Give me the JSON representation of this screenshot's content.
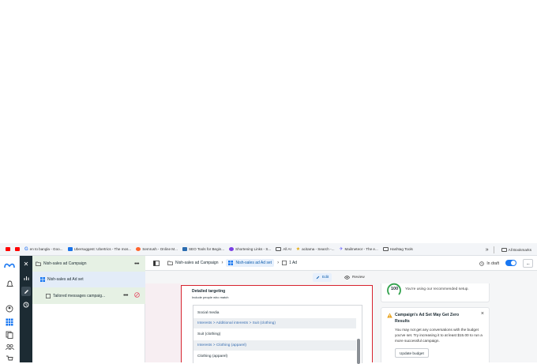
{
  "bookmarks": {
    "items": [
      {
        "label": "",
        "icon": "youtube-icon",
        "color": "#ff0000"
      },
      {
        "label": "",
        "icon": "youtube-icon",
        "color": "#ff0000"
      },
      {
        "label": "en to bangla - Goo...",
        "icon": "google-icon",
        "color": "#4285f4"
      },
      {
        "label": "Ubersuggest: Ubertrics - The mos...",
        "icon": "site-icon",
        "color": "#1a73e8"
      },
      {
        "label": "Semrush - Online M...",
        "icon": "semrush-icon",
        "color": "#ff642d"
      },
      {
        "label": "SEO Tools for Begin...",
        "icon": "site-icon",
        "color": "#2b6cb0"
      },
      {
        "label": "Shortening Links - S...",
        "icon": "site-icon",
        "color": "#7b3fe4"
      },
      {
        "label": "All AI",
        "icon": "folder-icon",
        "color": "#555555"
      },
      {
        "label": "acitama - Search -...",
        "icon": "site-icon",
        "color": "#e6a700"
      },
      {
        "label": "Mailmeteor - The e...",
        "icon": "site-icon",
        "color": "#6c63ff"
      },
      {
        "label": "Hashtag Tools",
        "icon": "folder-icon",
        "color": "#555555"
      }
    ],
    "overflow": "»",
    "all_bookmarks": "All Bookmarks"
  },
  "tree": {
    "campaign": "Nish-sales ad Campaign",
    "adset": "Nish-sales ad Ad set",
    "ad": "Tailored messages campaig..."
  },
  "breadcrumb": {
    "campaign": "Nish-sales ad Campaign",
    "adset": "Nish-sales ad Ad set",
    "ad": "1 Ad"
  },
  "status": {
    "draft": "In draft",
    "more": "..."
  },
  "modes": {
    "edit": "Edit",
    "review": "Review"
  },
  "targeting": {
    "title": "Detailed targeting",
    "subtitle": "Include people who match",
    "rows": [
      {
        "text": "Social media",
        "style": "plain"
      },
      {
        "text": "Interests > Additional interests > Suit (clothing)",
        "style": "link"
      },
      {
        "text": "Suit (clothing)",
        "style": "plain"
      },
      {
        "text": "Interests > Clothing (apparel)",
        "style": "link"
      },
      {
        "text": "Clothing (apparel)",
        "style": "plain"
      }
    ]
  },
  "recommend": {
    "score": "100",
    "text": "You're using our recommended setup."
  },
  "alert": {
    "title": "Campaign's Ad Set May Get Zero Results",
    "body": "You may not get any conversations with the budget you've set. Try increasing it to at least $15.00 to run a more successful campaign.",
    "button": "Update budget"
  },
  "colors": {
    "accent": "#1877f2",
    "alert_border": "#d7232e",
    "dark_rail": "#1c2b33",
    "success": "#31a24c",
    "warning": "#e9a21b"
  }
}
